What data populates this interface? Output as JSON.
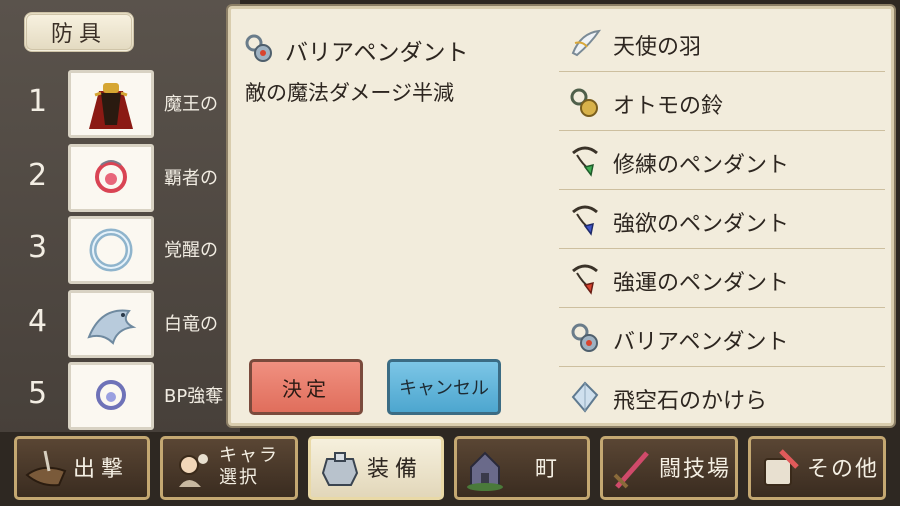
{
  "left_panel": {
    "tab_label": "防具",
    "rows": [
      {
        "num": "1",
        "name": "魔王の",
        "icon": "demon-cape-icon"
      },
      {
        "num": "2",
        "name": "覇者の",
        "icon": "conqueror-amulet-icon"
      },
      {
        "num": "3",
        "name": "覚醒の",
        "icon": "awakening-ring-icon"
      },
      {
        "num": "4",
        "name": "白竜の",
        "icon": "white-dragon-icon"
      },
      {
        "num": "5",
        "name": "BP強奪",
        "icon": "bp-steal-icon"
      }
    ]
  },
  "dialog": {
    "selected_name": "バリアペンダント",
    "selected_desc": "敵の魔法ダメージ半減",
    "ok_label": "決定",
    "cancel_label": "キャンセル",
    "items": [
      {
        "label": "天使の羽",
        "icon": "angel-feather-icon"
      },
      {
        "label": "オトモの鈴",
        "icon": "companion-bell-icon"
      },
      {
        "label": "修練のペンダント",
        "icon": "training-pendant-icon",
        "gem": "#3fae52"
      },
      {
        "label": "強欲のペンダント",
        "icon": "greed-pendant-icon",
        "gem": "#3f55c8"
      },
      {
        "label": "強運のペンダント",
        "icon": "luck-pendant-icon",
        "gem": "#d9442e"
      },
      {
        "label": "バリアペンダント",
        "icon": "barrier-pendant-icon"
      },
      {
        "label": "飛空石のかけら",
        "icon": "airship-stone-icon"
      }
    ]
  },
  "nav": [
    {
      "label": "出撃",
      "icon": "sortie-icon"
    },
    {
      "label": "キャラ\n選択",
      "icon": "character-select-icon"
    },
    {
      "label": "装備",
      "icon": "equipment-icon",
      "active": true
    },
    {
      "label": "町",
      "icon": "town-icon"
    },
    {
      "label": "闘技場",
      "icon": "arena-icon"
    },
    {
      "label": "その他",
      "icon": "other-icon"
    }
  ]
}
